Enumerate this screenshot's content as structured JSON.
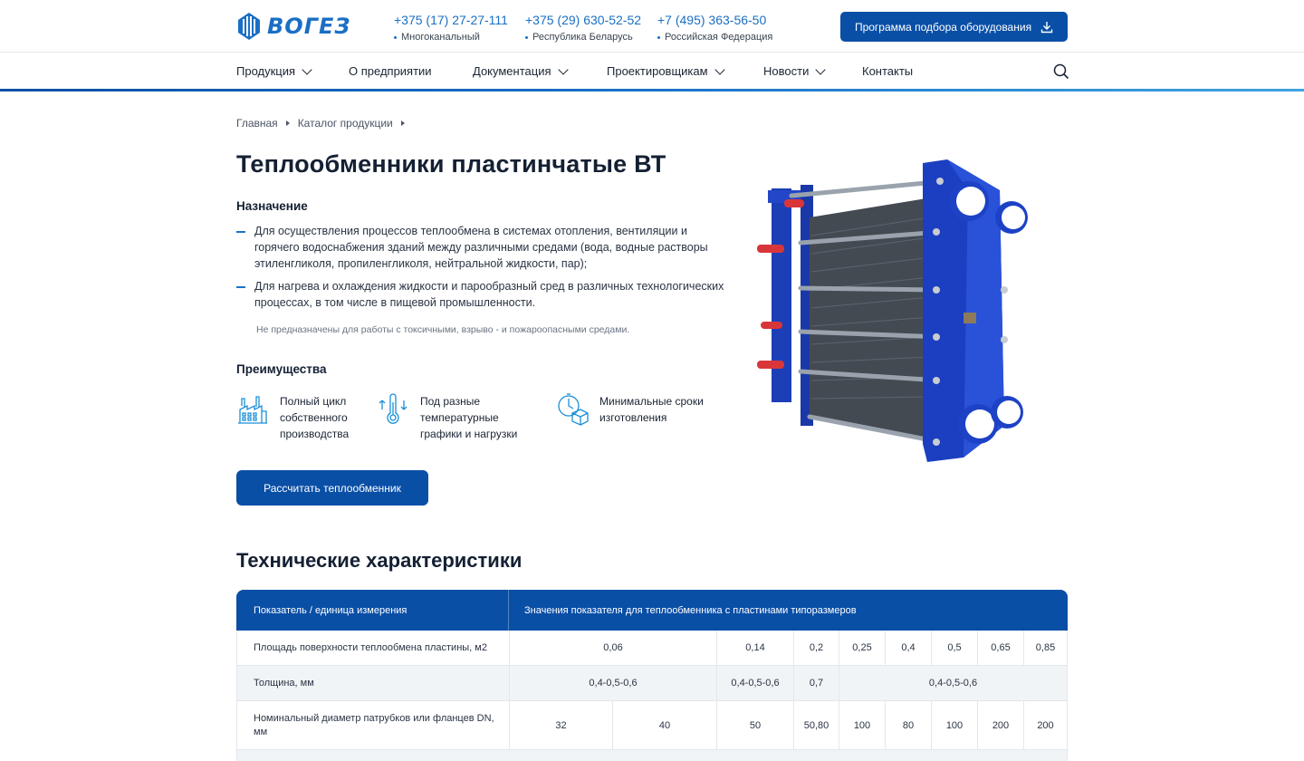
{
  "brand": {
    "name": "ВОГЕЗ",
    "accent": "#0a4fa6",
    "link": "#1a6fc4"
  },
  "header": {
    "phones": [
      {
        "number": "+375 (17) 27-27-111",
        "label": "Многоканальный"
      },
      {
        "number": "+375 (29) 630-52-52",
        "label": "Республика Беларусь"
      },
      {
        "number": "+7 (495) 363-56-50",
        "label": "Российская Федерация"
      }
    ],
    "program_button": "Программа подбора оборудования",
    "program_icon": "download-icon"
  },
  "nav": {
    "items": [
      {
        "label": "Продукция",
        "dropdown": true
      },
      {
        "label": "О предприятии",
        "dropdown": false
      },
      {
        "label": "Документация",
        "dropdown": true
      },
      {
        "label": "Проектировщикам",
        "dropdown": true
      },
      {
        "label": "Новости",
        "dropdown": true
      },
      {
        "label": "Контакты",
        "dropdown": false
      }
    ],
    "search_icon": "search-icon"
  },
  "breadcrumb": [
    "Главная",
    "Каталог продукции"
  ],
  "page": {
    "title": "Теплообменники пластинчатые ВТ",
    "purpose_heading": "Назначение",
    "purpose_items": [
      "Для осуществления процессов теплообмена в системах отопления, вентиляции и горячего водоснабжения зданий между различными средами (вода, водные растворы этиленгликоля, пропиленгликоля, нейтральной жидкости, пар);",
      "Для нагрева и охлаждения жидкости и парообразный сред в различных технологических процессах, в том числе в пищевой промышленности."
    ],
    "note": "Не предназначены для работы с токсичными, взрыво - и пожароопасными средами.",
    "advantages_heading": "Преимущества",
    "advantages": [
      {
        "icon": "factory-icon",
        "text": "Полный цикл собственного производства"
      },
      {
        "icon": "thermometer-icon",
        "text": "Под разные температурные графики и нагрузки"
      },
      {
        "icon": "stopwatch-box-icon",
        "text": "Минимальные сроки изготовления"
      }
    ],
    "calc_button": "Рассчитать теплообменник",
    "product_image": "plate-heat-exchanger-image"
  },
  "specs": {
    "heading": "Технические характеристики",
    "col_header_1": "Показатель / единица измерения",
    "col_header_2": "Значения показателя для теплообменника с пластинами типоразмеров",
    "rows": [
      {
        "label": "Площадь поверхности теплообмена пластины, м2",
        "cells": [
          "0,06",
          "0,14",
          "0,2",
          "0,25",
          "0,4",
          "0,5",
          "0,65",
          "0,85"
        ]
      },
      {
        "label": "Толщина, мм",
        "cells": [
          "0,4-0,5-0,6",
          "0,4-0,5-0,6",
          "0,7",
          "0,4-0,5-0,6"
        ]
      },
      {
        "label": "Номинальный диаметр патрубков или фланцев DN, мм",
        "cells": [
          "32",
          "40",
          "50",
          "50,80",
          "100",
          "80",
          "100",
          "200",
          "200"
        ]
      }
    ]
  }
}
